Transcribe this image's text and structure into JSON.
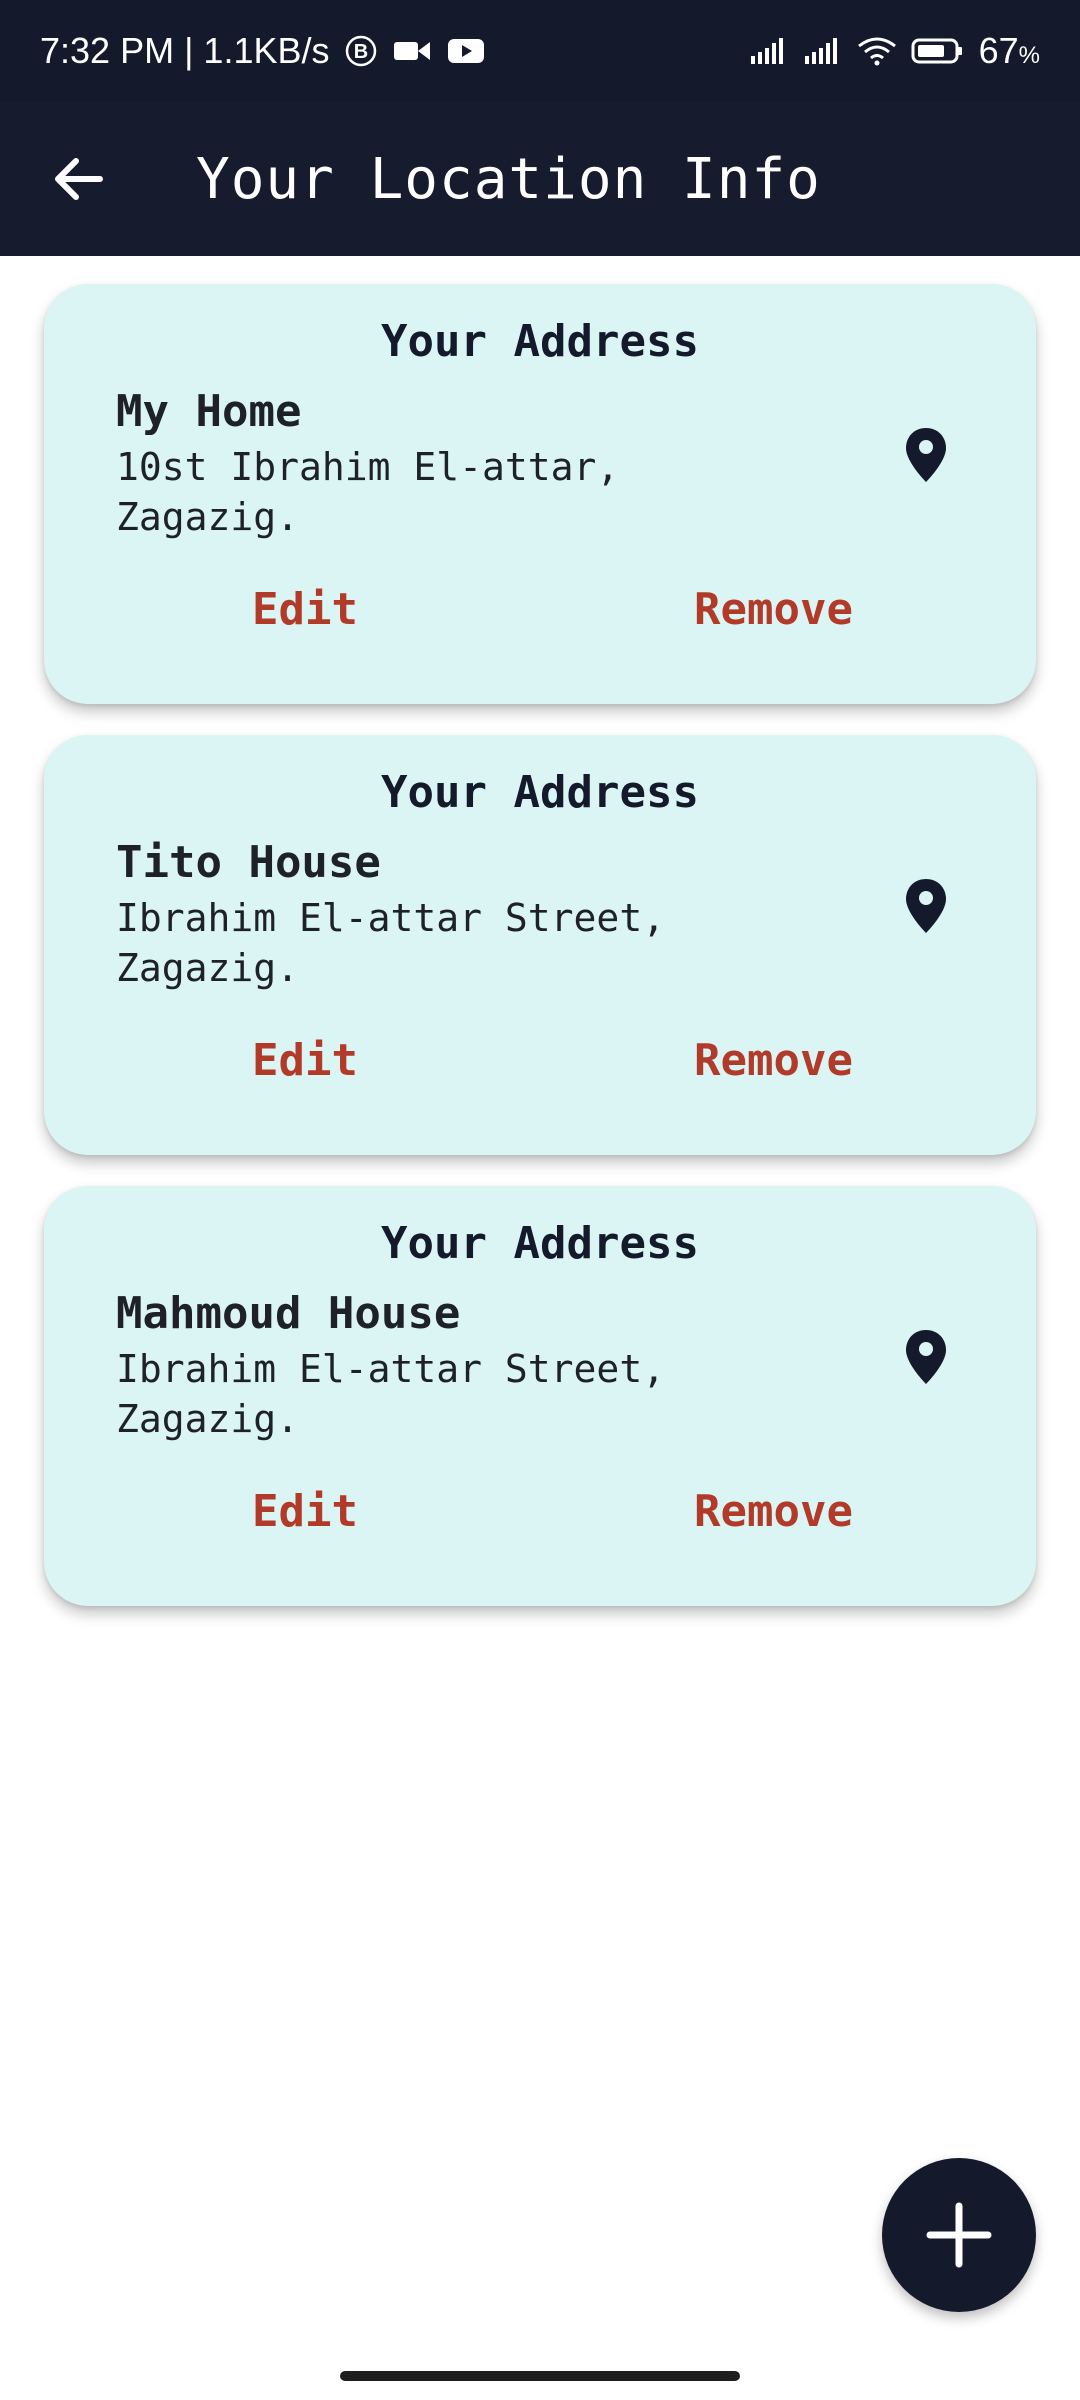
{
  "status_bar": {
    "time_info": "7:32 PM | 1.1KB/s",
    "battery_percent": "67",
    "battery_unit": "%",
    "icons": [
      "bluetooth-b-icon",
      "video-call-icon",
      "youtube-icon",
      "signal-icon",
      "signal-icon",
      "wifi-icon",
      "battery-icon"
    ]
  },
  "app_bar": {
    "title": "Your Location Info",
    "back_icon": "arrow-left-icon"
  },
  "addresses": [
    {
      "heading": "Your Address",
      "name": "My Home",
      "address": "10st Ibrahim El-attar, Zagazig.",
      "edit_label": "Edit",
      "remove_label": "Remove"
    },
    {
      "heading": "Your Address",
      "name": "Tito House",
      "address": "Ibrahim El-attar Street, Zagazig.",
      "edit_label": "Edit",
      "remove_label": "Remove"
    },
    {
      "heading": "Your Address",
      "name": "Mahmoud House",
      "address": "Ibrahim El-attar Street, Zagazig.",
      "edit_label": "Edit",
      "remove_label": "Remove"
    }
  ],
  "fab": {
    "icon": "plus-icon"
  },
  "colors": {
    "header_bg": "#161c2e",
    "card_bg": "#dbf4f4",
    "action_red": "#b23a28",
    "dark_text": "#141a2c"
  }
}
